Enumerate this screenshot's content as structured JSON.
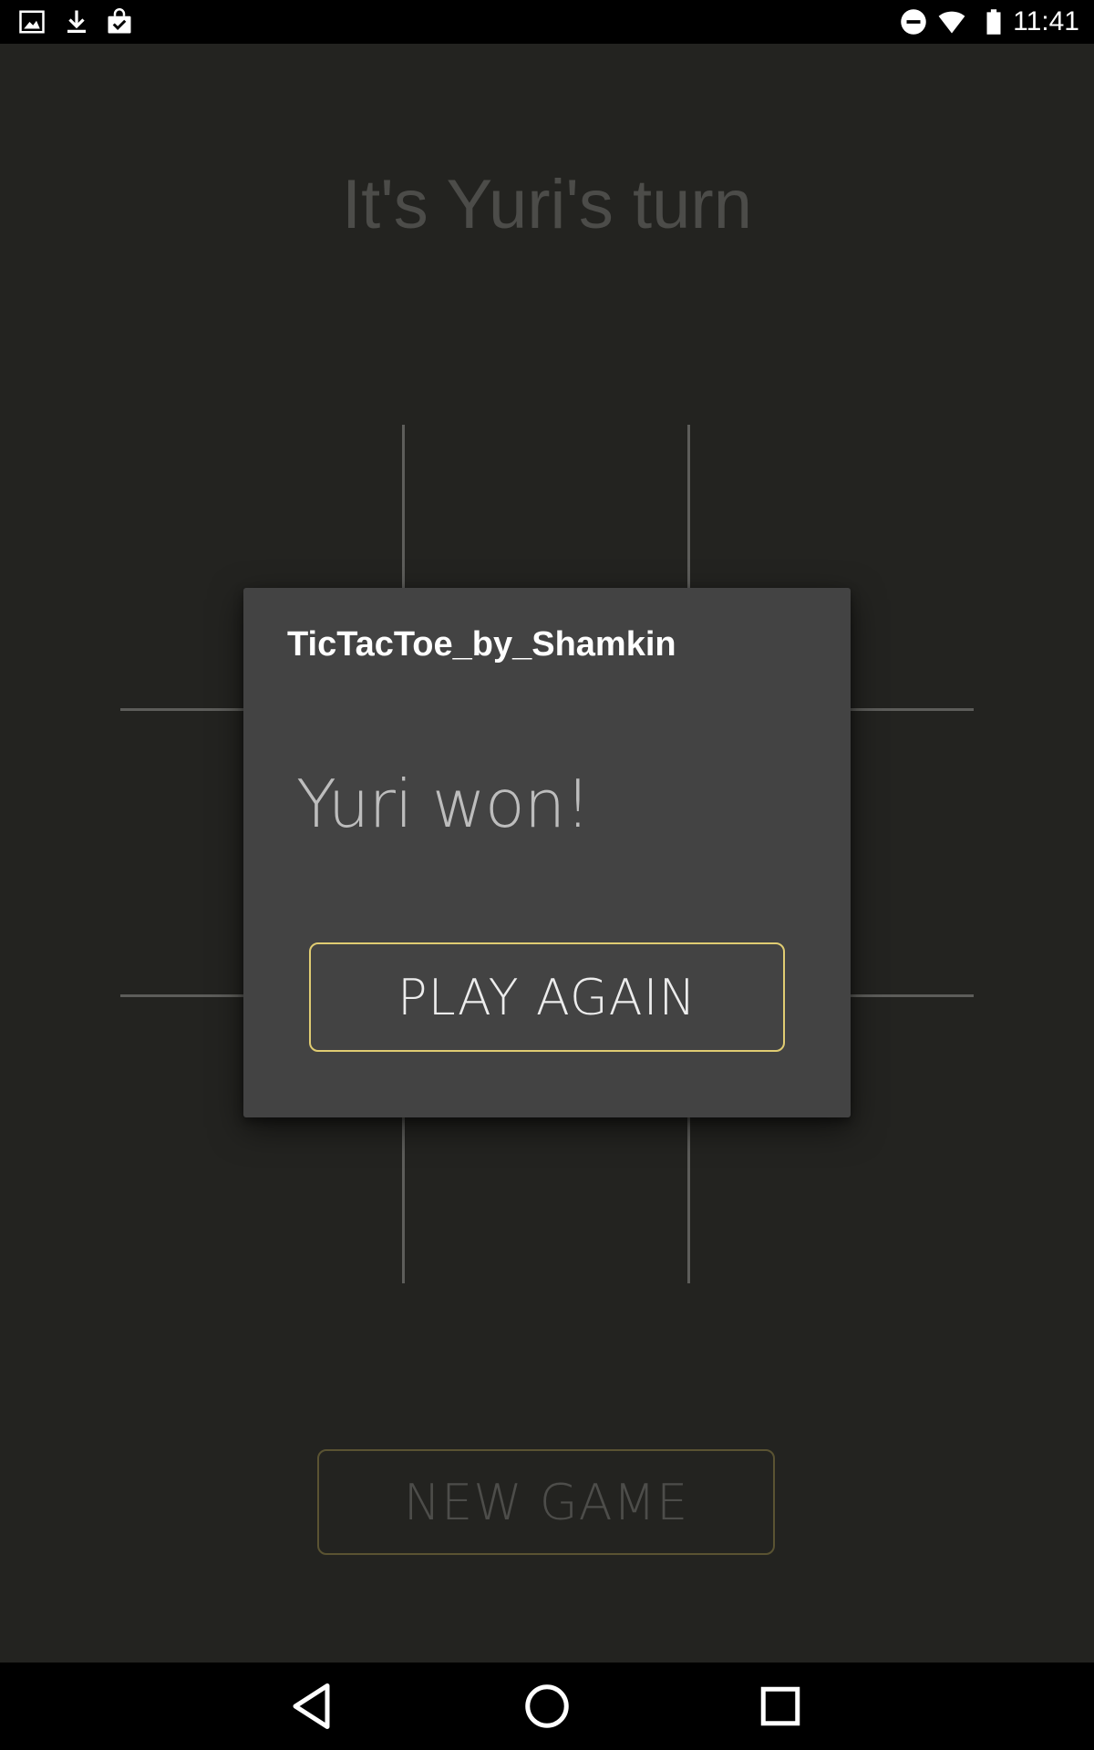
{
  "status_bar": {
    "time": "11:41",
    "left_icons": [
      "image-icon",
      "download-icon",
      "store-bag-icon"
    ],
    "right_icons": [
      "do-not-disturb-icon",
      "wifi-icon",
      "battery-icon"
    ]
  },
  "game": {
    "turn_text": "It's Yuri's turn",
    "new_game_label": "NEW GAME"
  },
  "dialog": {
    "title": "TicTacToe_by_Shamkin",
    "message": "Yuri won!",
    "play_again_label": "PLAY AGAIN"
  },
  "nav_bar": {
    "buttons": [
      "back-icon",
      "home-icon",
      "recents-icon"
    ]
  },
  "colors": {
    "background": "#232320",
    "dialog_background": "#434343",
    "accent_border": "#e0cc72"
  }
}
